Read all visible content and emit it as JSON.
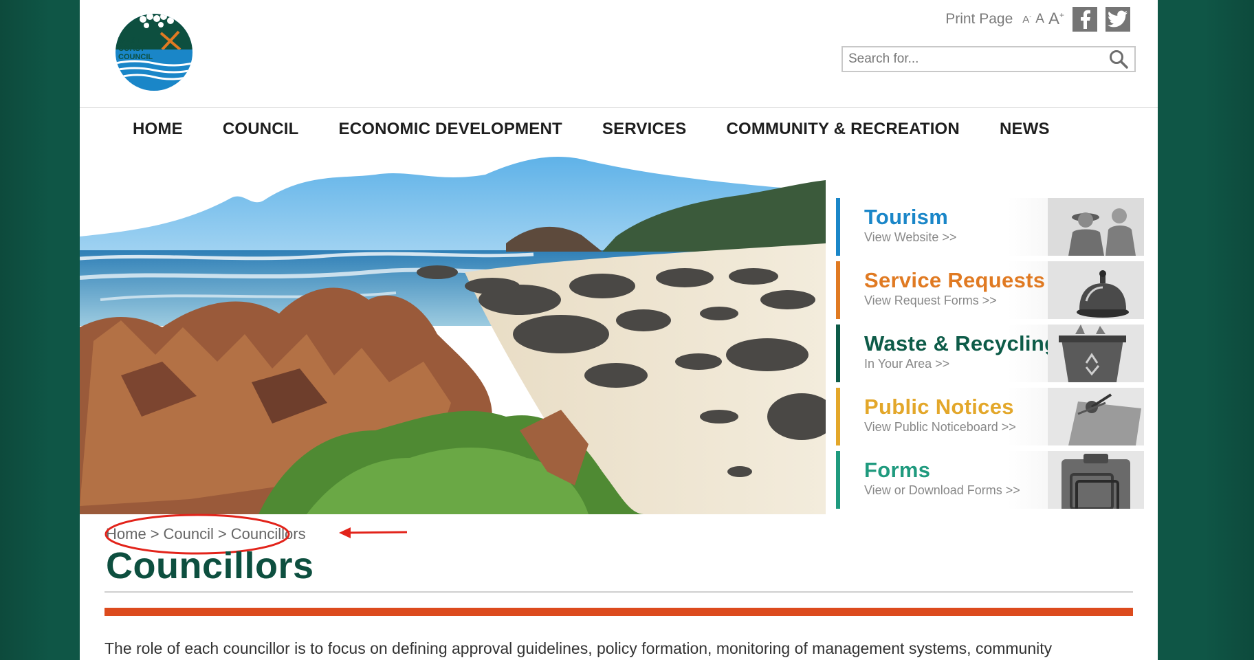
{
  "header": {
    "logo_text": [
      "WEST",
      "COAST",
      "COUNCIL"
    ],
    "print_label": "Print Page",
    "font_size_small": "A",
    "font_size_medium": "A",
    "font_size_large": "A",
    "font_size_plus": "+",
    "font_size_minus": "-",
    "social": [
      {
        "name": "facebook",
        "icon": "facebook-icon"
      },
      {
        "name": "twitter",
        "icon": "twitter-icon"
      }
    ],
    "search_placeholder": "Search for..."
  },
  "nav": {
    "items": [
      {
        "label": "HOME"
      },
      {
        "label": "COUNCIL"
      },
      {
        "label": "ECONOMIC DEVELOPMENT"
      },
      {
        "label": "SERVICES"
      },
      {
        "label": "COMMUNITY & RECREATION"
      },
      {
        "label": "NEWS"
      }
    ]
  },
  "tiles": [
    {
      "title": "Tourism",
      "sub": "View Website >>",
      "color": "#1a86c8",
      "icon": "hikers-icon"
    },
    {
      "title": "Service Requests",
      "sub": "View Request Forms >>",
      "color": "#e07a22",
      "icon": "service-bell-icon"
    },
    {
      "title": "Waste & Recycling",
      "sub": "In Your Area >>",
      "color": "#0d5b48",
      "icon": "recycle-bin-icon"
    },
    {
      "title": "Public Notices",
      "sub": "View Public Noticeboard >>",
      "color": "#e3a72a",
      "icon": "notice-pin-icon"
    },
    {
      "title": "Forms",
      "sub": "View or Download Forms >>",
      "color": "#1f9a7e",
      "icon": "clipboard-icon"
    }
  ],
  "breadcrumb": {
    "items": [
      "Home",
      "Council",
      "Councillors"
    ],
    "separator": ">"
  },
  "main": {
    "title": "Councillors",
    "intro": "The role of each councillor is to focus on defining approval guidelines, policy formation, monitoring of management systems, community"
  },
  "colors": {
    "background": "#0f5646",
    "title": "#0d4f3f",
    "accent_bar": "#dc4b1e",
    "annotation": "#e2231a"
  }
}
